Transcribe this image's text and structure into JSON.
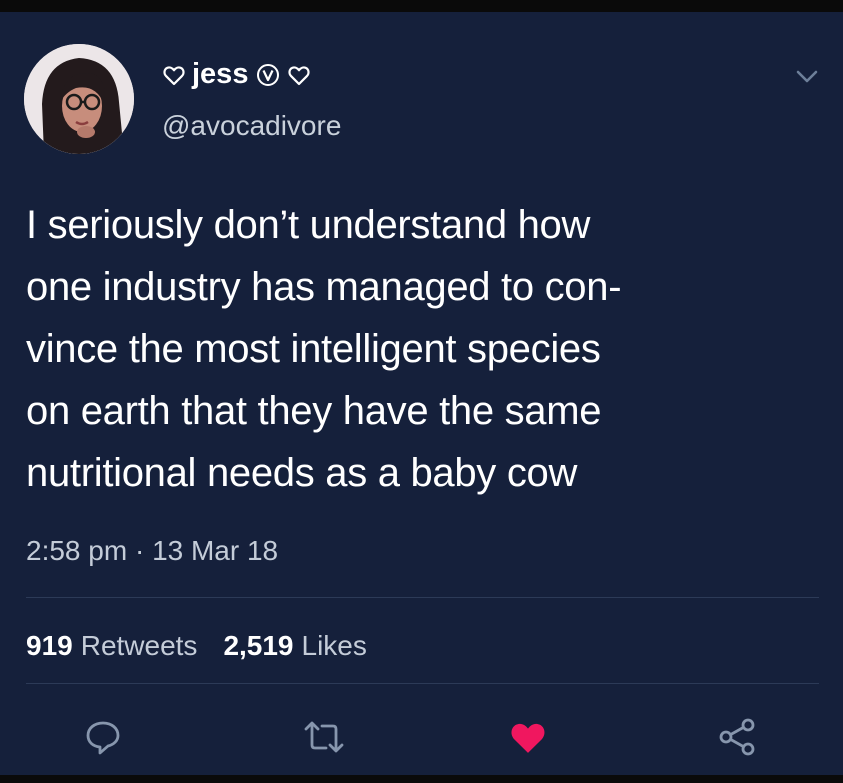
{
  "user": {
    "name": "jess",
    "handle": "@avocadivore"
  },
  "tweet": {
    "lines": [
      "I seriously don’t understand how",
      "one industry has managed to con-",
      "vince the most intelligent species",
      "on earth that they have the same",
      "nutritional needs as a baby cow"
    ],
    "time": "2:58 pm",
    "separator": "·",
    "date": "13 Mar 18"
  },
  "stats": {
    "retweets_count": "919",
    "retweets_label": "Retweets",
    "likes_count": "2,519",
    "likes_label": "Likes"
  },
  "actions": {
    "liked": true
  },
  "colors": {
    "background": "#15203b",
    "text": "#ffffff",
    "secondary_text": "#c4ccd8",
    "like_active": "#f0175f"
  },
  "icons": [
    "heart-outline-icon",
    "verified-icon",
    "chevron-down-icon",
    "reply-icon",
    "retweet-icon",
    "like-icon",
    "share-icon"
  ]
}
